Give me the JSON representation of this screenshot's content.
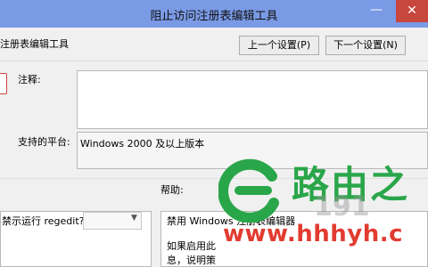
{
  "window": {
    "title": "阻止访问注册表编辑工具",
    "minimize_glyph": "—",
    "close_glyph": "✕"
  },
  "header": {
    "policy_name": "注册表编辑工具",
    "prev_button": "上一个设置(P)",
    "next_button": "下一个设置(N)"
  },
  "form": {
    "comment_label": "注释:",
    "comment_value": "",
    "platform_label": "支持的平台:",
    "platform_value": "Windows 2000 及以上版本"
  },
  "options": {
    "question": "禁示运行 regedit?"
  },
  "help": {
    "label": "帮助:",
    "line1": "禁用 Windows 注册表编辑器",
    "line2": "如果启用此",
    "line3": "息，说明策"
  },
  "watermark": {
    "brand": "路由之",
    "site": "www.hhhyh.c",
    "number": "191",
    "color_brand": "#2aa64a",
    "color_site": "#e23b30"
  }
}
